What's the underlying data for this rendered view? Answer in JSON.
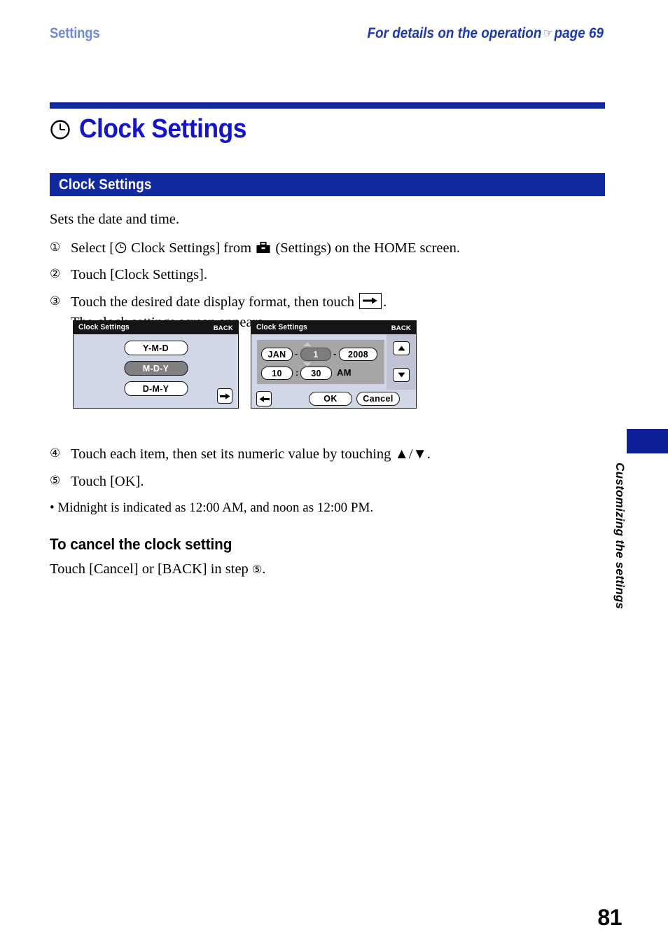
{
  "header": {
    "left_label": "Settings",
    "right_label_pre": "For details on the operation",
    "hand_icon": "☞",
    "right_label_post": "page 69"
  },
  "title": {
    "icon": "clock-icon",
    "text": "Clock Settings"
  },
  "section_banner": {
    "label": "Clock Settings"
  },
  "body": {
    "lead": "Sets the date and time.",
    "steps": [
      {
        "num": "①",
        "pre": "Select [",
        "icon": "clock-icon",
        "mid": " Clock Settings] from ",
        "icon2": "toolbox-icon",
        "post": " (Settings) on the HOME screen."
      },
      {
        "num": "②",
        "text": "Touch [Clock Settings]."
      },
      {
        "num": "③",
        "pre": "Touch the desired date display format, then touch ",
        "icon": "arrow-right-box-icon",
        "post": ".",
        "sub": "The clock settings screen appears."
      },
      {
        "num": "④",
        "text": "Touch each item, then set its numeric value by touching ▲/▼."
      },
      {
        "num": "⑤",
        "text": "Touch [OK]."
      }
    ],
    "bullet": "• Midnight is indicated as 12:00 AM, and noon as 12:00 PM.",
    "subhead": "To cancel the clock setting",
    "cancel_line_pre": "Touch [Cancel] or [BACK] in step ",
    "cancel_line_num": "⑤",
    "cancel_line_post": "."
  },
  "screens": {
    "left": {
      "title": "Clock Settings",
      "back": "BACK",
      "format_buttons": [
        {
          "label": "Y-M-D",
          "selected": false
        },
        {
          "label": "M-D-Y",
          "selected": true
        },
        {
          "label": "D-M-Y",
          "selected": false
        }
      ],
      "forward_icon": "arrow-right-icon"
    },
    "right": {
      "title": "Clock Settings",
      "back": "BACK",
      "date": {
        "month": "JAN",
        "sep1": "-",
        "day": "1",
        "day_selected": true,
        "sep2": "-",
        "year": "2008"
      },
      "time": {
        "hour": "10",
        "colon": ":",
        "minute": "30",
        "ampm": "AM"
      },
      "spin_up_icon": "triangle-up-icon",
      "spin_down_icon": "triangle-down-icon",
      "back_icon": "arrow-left-icon",
      "ok_label": "OK",
      "cancel_label": "Cancel"
    }
  },
  "side_tab": {
    "label": "Customizing the settings"
  },
  "page_number": "81",
  "colors": {
    "brand_blue": "#112b9e",
    "title_blue": "#1414c8",
    "header_light_blue": "#6f8ad6",
    "header_blue": "#1f39b5",
    "screen_bg": "#d2d7e8",
    "screen_titlebar": "#151515",
    "panel_gray": "#a6a6a6",
    "selected_gray": "#7d7d7d"
  }
}
